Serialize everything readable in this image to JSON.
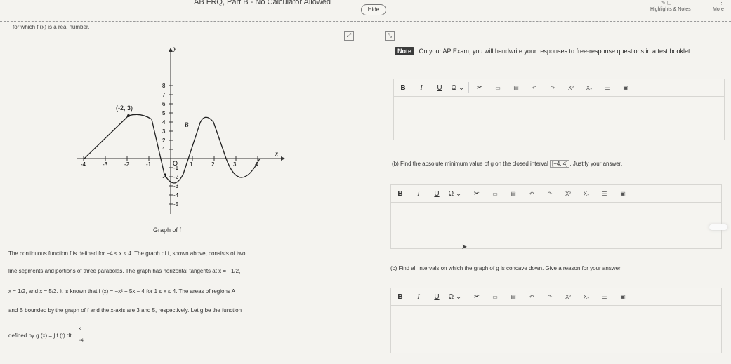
{
  "header": {
    "exam_title": "AB FRQ, Part B - No Calculator Allowed",
    "hide_label": "Hide",
    "highlights_label": "Highlights & Notes",
    "more_label": "More"
  },
  "left": {
    "intro": "for which f (x) is a real number.",
    "graph": {
      "x_ticks": [
        "-4",
        "-3",
        "-2",
        "-1",
        "1",
        "2",
        "3",
        "4"
      ],
      "y_ticks": [
        "8",
        "7",
        "6",
        "5",
        "4",
        "3",
        "2",
        "1",
        "-1",
        "-2",
        "-3",
        "-4",
        "-5"
      ],
      "x_label": "x",
      "y_label": "y",
      "point_label": "(-2, 3)",
      "origin_label": "O",
      "region_a": "A",
      "region_b": "B"
    },
    "graph_caption": "Graph of f",
    "paragraph": [
      "The continuous function f is defined for −4 ≤ x ≤ 4. The graph of f, shown above, consists of two",
      "line segments and portions of three parabolas. The graph has horizontal tangents at x = −1/2,",
      "x = 1/2, and x = 5/2. It is known that f (x) = −x² + 5x − 4 for 1 ≤ x ≤ 4. The areas of regions A",
      "and B bounded by the graph of f and the x-axis are 3 and 5, respectively. Let g be the function",
      "defined by g (x) = ∫ f (t) dt."
    ],
    "integral_lower": "−4",
    "integral_upper": "x"
  },
  "right": {
    "note_badge": "Note",
    "note_text": "On your AP Exam, you will handwrite your responses to free-response questions in a test booklet",
    "toolbar": {
      "bold": "B",
      "italic": "I",
      "underline": "U",
      "omega": "Ω",
      "sup": "X²",
      "sub": "X₂"
    },
    "question_b_pre": "(b) Find the absolute minimum value of g on the closed interval",
    "question_b_interval": "[−4, 4]",
    "question_b_post": ". Justify your answer.",
    "question_c": "(c) Find all intervals on which the graph of g is concave down. Give a reason for your answer."
  }
}
